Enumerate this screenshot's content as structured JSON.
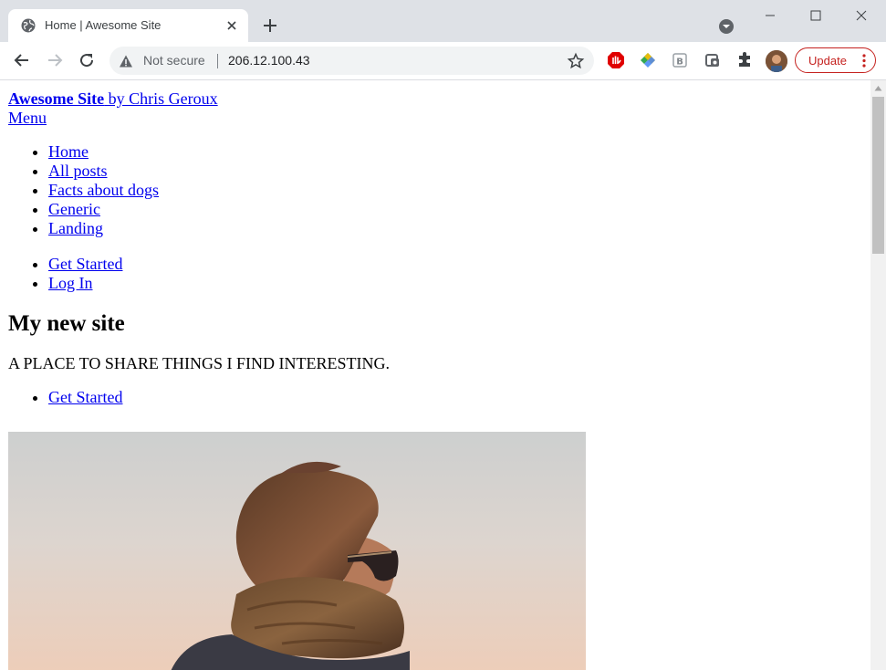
{
  "browser": {
    "tab_title": "Home | Awesome Site",
    "security_label": "Not secure",
    "url": "206.12.100.43",
    "update_label": "Update"
  },
  "page": {
    "brand_name": "Awesome Site",
    "brand_by": " by Chris Geroux",
    "menu_label": "Menu",
    "nav_items": [
      "Home",
      "All posts",
      "Facts about dogs",
      "Generic",
      "Landing"
    ],
    "account_items": [
      "Get Started",
      "Log In"
    ],
    "heading": "My new site",
    "tagline": "A PLACE TO SHARE THINGS I FIND INTERESTING.",
    "cta_items": [
      "Get Started"
    ]
  },
  "colors": {
    "link": "#0000ee",
    "tabstrip": "#dee1e6",
    "update_accent": "#c5221f"
  }
}
